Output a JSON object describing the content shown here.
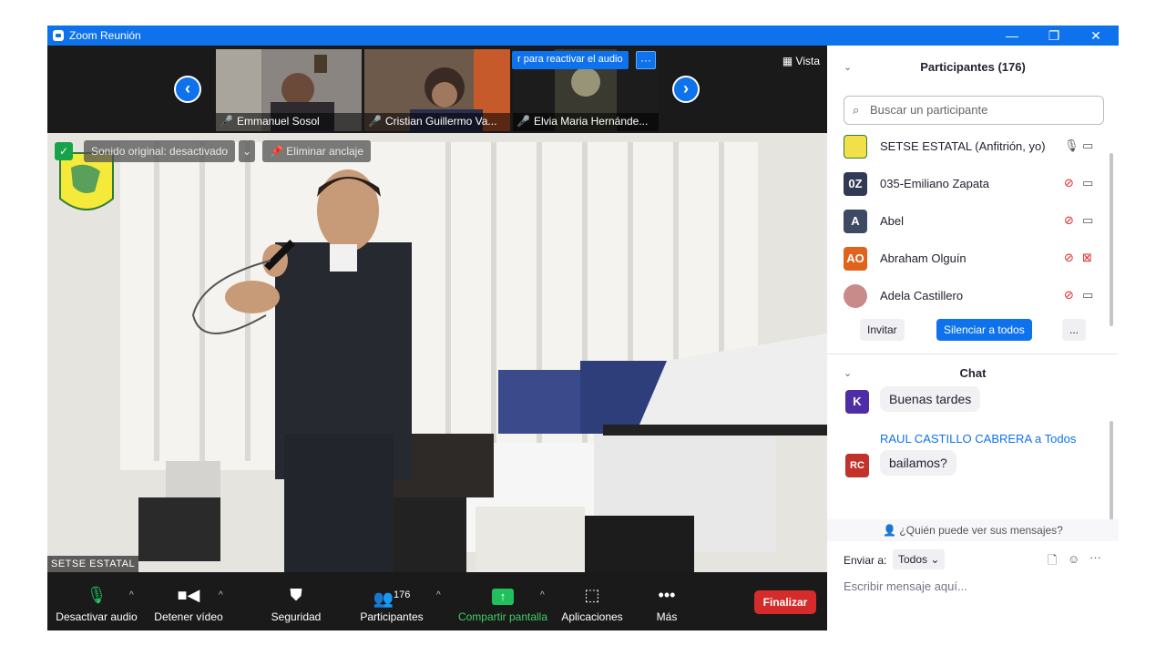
{
  "window": {
    "title": "Zoom Reunión",
    "controls": [
      "—",
      "❐",
      "✕"
    ]
  },
  "strip": {
    "thumbnails": [
      {
        "name": "Emmanuel Sosol"
      },
      {
        "name": "Cristian Guillermo Va..."
      },
      {
        "name": "Elvia Maria Hernánde..."
      }
    ],
    "reactivate_label": "r para reactivar el audio",
    "more_label": "···",
    "vista_label": "Vista"
  },
  "main_video": {
    "speaker_name": "SETSE ESTATAL",
    "original_sound": "Sonido original: desactivado",
    "unpin": "Eliminar anclaje"
  },
  "toolbar": {
    "mute": "Desactivar audio",
    "video": "Detener vídeo",
    "security": "Seguridad",
    "participants": "Participantes",
    "participants_count": "176",
    "share": "Compartir pantalla",
    "apps": "Aplicaciones",
    "more": "Más",
    "end": "Finalizar"
  },
  "participants_panel": {
    "title": "Participantes (176)",
    "search_placeholder": "Buscar un participante",
    "rows": [
      {
        "initials": "",
        "name": "SETSE ESTATAL (Anfitrión, yo)",
        "color": "#f2e04a",
        "muted": false,
        "video_off": false
      },
      {
        "initials": "0Z",
        "name": "035-Emiliano Zapata",
        "color": "#2f3b55",
        "muted": true,
        "video_off": false
      },
      {
        "initials": "A",
        "name": "Abel",
        "color": "#3c4b63",
        "muted": true,
        "video_off": false
      },
      {
        "initials": "AO",
        "name": "Abraham Olguín",
        "color": "#e0631c",
        "muted": true,
        "video_off": true
      },
      {
        "initials": "",
        "name": "Adela Castillero",
        "color": "#c98a8a",
        "muted": true,
        "video_off": false
      }
    ],
    "invite": "Invitar",
    "mute_all": "Silenciar a todos",
    "more": "..."
  },
  "chat_panel": {
    "title": "Chat",
    "messages": [
      {
        "initials": "K",
        "color": "#4f2ea5",
        "sender": "",
        "text": "Buenas tardes"
      },
      {
        "initials": "RC",
        "color": "#c2312a",
        "sender": "RAUL CASTILLO CABRERA",
        "to": "a Todos",
        "text": "bailamos?"
      }
    ],
    "who_can_see": "¿Quién puede ver sus mensajes?",
    "send_to_label": "Enviar a:",
    "send_to_value": "Todos",
    "input_placeholder": "Escribir mensaje aquí..."
  }
}
